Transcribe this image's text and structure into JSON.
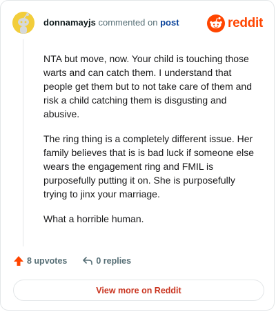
{
  "comment": {
    "username": "donnamayjs",
    "action_text": "commented on",
    "post_link": "post",
    "paragraphs": [
      "NTA but move, now. Your child is touching those warts and can catch them. I understand that people get them but to not take care of them and risk a child catching them is disgusting and abusive.",
      "The ring thing is a completely different issue. Her family believes that is is bad luck if someone else wears the engagement ring and FMIL is purposefully putting it on. She is purposefully trying to jinx your marriage.",
      "What a horrible human."
    ]
  },
  "brand": {
    "name": "reddit",
    "color": "#ff4500"
  },
  "actions": {
    "upvotes": "8 upvotes",
    "replies": "0 replies"
  },
  "footer": {
    "button_label": "View more on Reddit"
  },
  "icons": {
    "avatar": "snoo-avatar-icon",
    "logo": "reddit-logo-icon",
    "upvote": "upvote-arrow-icon",
    "reply": "reply-arrow-icon"
  }
}
